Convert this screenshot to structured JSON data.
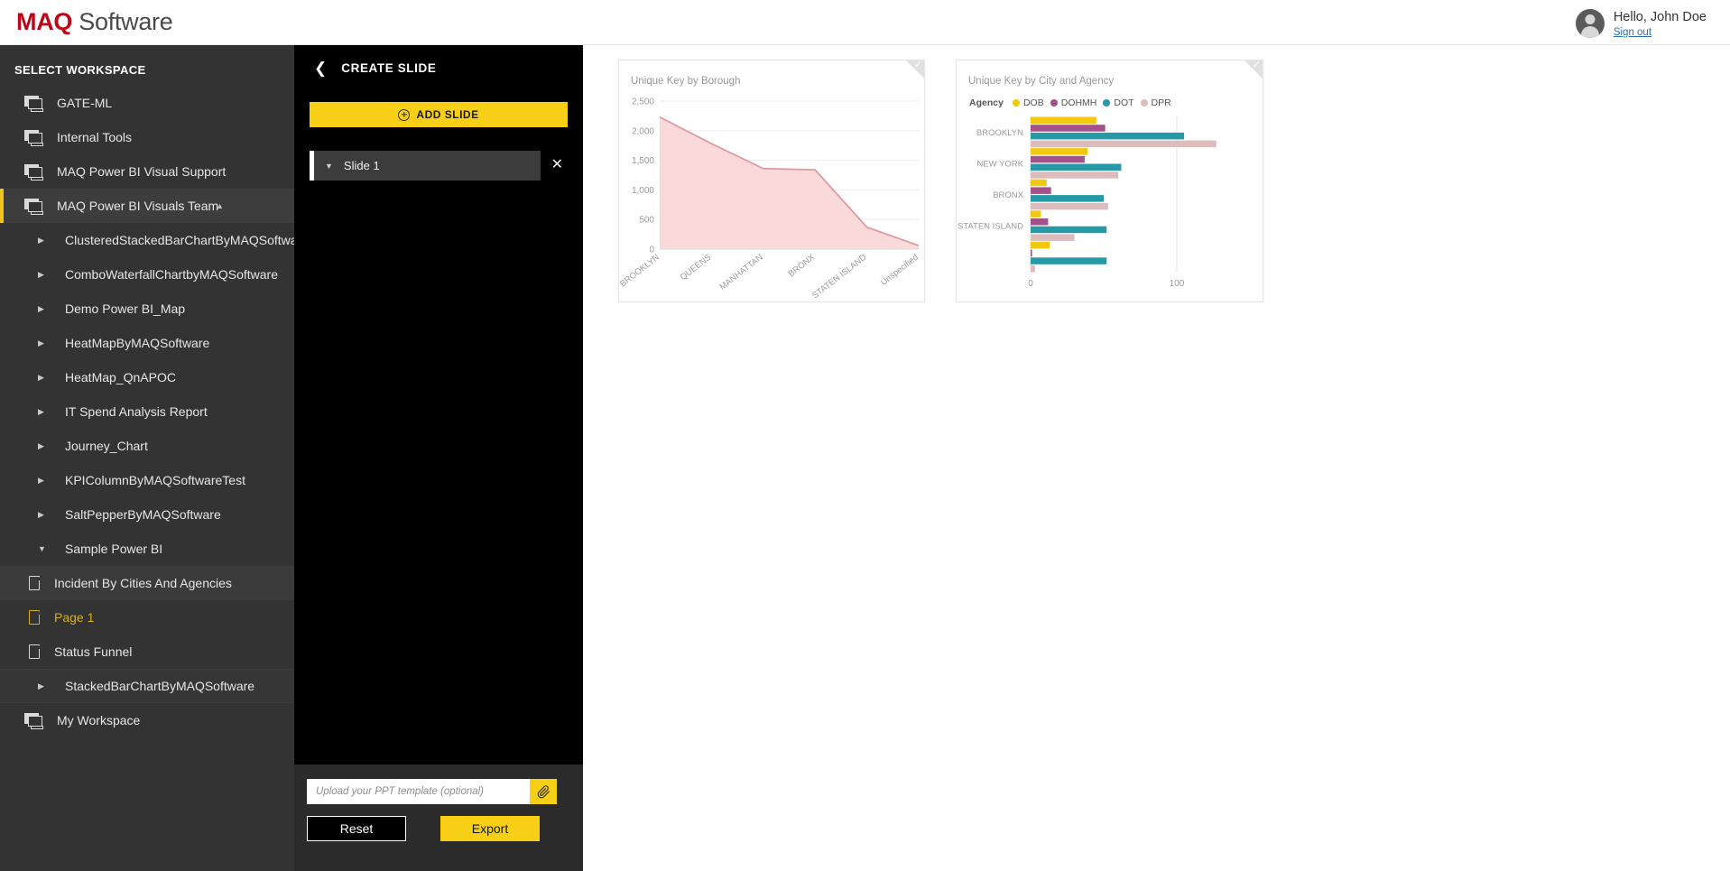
{
  "topbar": {
    "logo_maq": "MAQ",
    "logo_software": " Software",
    "greeting": "Hello, John Doe",
    "signout": "Sign out",
    "avatar_icon": "user-avatar-icon"
  },
  "sidebar": {
    "title": "SELECT WORKSPACE",
    "workspaces": [
      {
        "label": "GATE-ML",
        "icon": "workspace-icon",
        "active": false
      },
      {
        "label": "Internal Tools",
        "icon": "workspace-icon",
        "active": false
      },
      {
        "label": "MAQ Power BI Visual Support",
        "icon": "workspace-icon",
        "active": false
      },
      {
        "label": "MAQ Power BI Visuals Team",
        "icon": "workspace-icon",
        "active": true,
        "caret": "▲"
      }
    ],
    "reports": [
      {
        "label": "ClusteredStackedBarChartByMAQSoftware",
        "caret": "▶"
      },
      {
        "label": "ComboWaterfallChartbyMAQSoftware",
        "caret": "▶"
      },
      {
        "label": "Demo Power BI_Map",
        "caret": "▶"
      },
      {
        "label": "HeatMapByMAQSoftware",
        "caret": "▶"
      },
      {
        "label": "HeatMap_QnAPOC",
        "caret": "▶"
      },
      {
        "label": "IT Spend Analysis Report",
        "caret": "▶"
      },
      {
        "label": "Journey_Chart",
        "caret": "▶"
      },
      {
        "label": "KPIColumnByMAQSoftwareTest",
        "caret": "▶"
      },
      {
        "label": "SaltPepperByMAQSoftware",
        "caret": "▶"
      },
      {
        "label": "Sample Power BI",
        "caret": "▼",
        "expanded": true
      }
    ],
    "pages": [
      {
        "label": "Incident By Cities And Agencies",
        "icon": "page-icon",
        "selected": false
      },
      {
        "label": "Page 1",
        "icon": "page-icon",
        "selected": true
      },
      {
        "label": "Status Funnel",
        "icon": "page-icon",
        "selected": false
      }
    ],
    "reports_after": [
      {
        "label": "StackedBarChartByMAQSoftware",
        "caret": "▶"
      }
    ],
    "my_workspace": {
      "label": "My Workspace",
      "icon": "workspace-icon"
    }
  },
  "panel": {
    "back_icon": "chevron-left-icon",
    "title": "CREATE SLIDE",
    "add_slide_label": "ADD SLIDE",
    "add_slide_icon": "plus-circle-icon",
    "slides": [
      {
        "label": "Slide 1",
        "caret": "▼",
        "close_icon": "close-icon",
        "close_glyph": "✕"
      }
    ],
    "upload_placeholder": "Upload your PPT template (optional)",
    "upload_value": "",
    "attach_icon": "paperclip-icon",
    "reset_label": "Reset",
    "export_label": "Export"
  },
  "colors": {
    "brand_red": "#c00418",
    "accent_yellow": "#f7cf16",
    "sidebar_bg": "#333333",
    "panel_bg": "#000000",
    "selected_page": "#d8b019"
  },
  "chart_data": [
    {
      "type": "area",
      "title": "Unique Key by Borough",
      "xlabel": "",
      "ylabel": "",
      "categories": [
        "BROOKLYN",
        "QUEENS",
        "MANHATTAN",
        "BRONX",
        "STATEN ISLAND",
        "Unspecified"
      ],
      "values": [
        2230,
        1780,
        1360,
        1340,
        370,
        60
      ],
      "ylim": [
        0,
        2500
      ],
      "yticks": [
        0,
        500,
        1000,
        1500,
        2000,
        2500
      ],
      "ytick_labels": [
        "0",
        "500",
        "1,000",
        "1,500",
        "2,000",
        "2,500"
      ],
      "grid": true,
      "series_color": "#e09a9f",
      "fill_color": "#f9d2d4"
    },
    {
      "type": "bar",
      "orientation": "horizontal",
      "title": "Unique Key by City and Agency",
      "legend_title": "Agency",
      "legend_position": "top",
      "xlabel": "",
      "ylabel": "",
      "categories": [
        "BROOKLYN",
        "NEW YORK",
        "BRONX",
        "STATEN ISLAND",
        ""
      ],
      "series": [
        {
          "name": "DOB",
          "color": "#f2c811",
          "values": [
            45,
            39,
            11,
            7,
            13
          ]
        },
        {
          "name": "DOHMH",
          "color": "#a4518b",
          "values": [
            51,
            37,
            14,
            12,
            1
          ]
        },
        {
          "name": "DOT",
          "color": "#2699a6",
          "values": [
            105,
            62,
            50,
            52,
            52
          ]
        },
        {
          "name": "DPR",
          "color": "#ddbcbd",
          "values": [
            127,
            60,
            53,
            30,
            3
          ]
        }
      ],
      "xlim": [
        0,
        150
      ],
      "xticks": [
        0,
        100
      ],
      "xtick_labels": [
        "0",
        "100"
      ],
      "grid": true
    }
  ]
}
